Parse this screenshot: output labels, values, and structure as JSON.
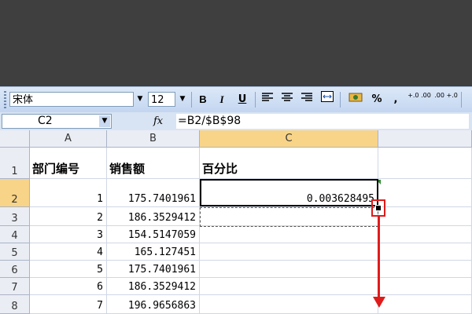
{
  "toolbar": {
    "font_name": "宋体",
    "font_size": "12",
    "bold": "B",
    "italic": "I",
    "underline": "U",
    "percent": "%",
    "comma": ",",
    "inc_decimal": "+.0 .00",
    "dec_decimal": ".00 +.0"
  },
  "formula_bar": {
    "name_box": "C2",
    "fx": "fx",
    "formula": "=B2/$B$98"
  },
  "columns": [
    "A",
    "B",
    "C"
  ],
  "selected_column": "C",
  "selected_row": "2",
  "rows": [
    {
      "row": "1",
      "a": "部门编号",
      "b": "销售额",
      "c": "百分比"
    },
    {
      "row": "2",
      "a": "1",
      "b": "175.7401961",
      "c": "0.003628495"
    },
    {
      "row": "3",
      "a": "2",
      "b": "186.3529412",
      "c": ""
    },
    {
      "row": "4",
      "a": "3",
      "b": "154.5147059",
      "c": ""
    },
    {
      "row": "5",
      "a": "4",
      "b": "165.127451",
      "c": ""
    },
    {
      "row": "6",
      "a": "5",
      "b": "175.7401961",
      "c": ""
    },
    {
      "row": "7",
      "a": "6",
      "b": "186.3529412",
      "c": ""
    },
    {
      "row": "8",
      "a": "7",
      "b": "196.9656863",
      "c": ""
    }
  ],
  "annotation_color": "#e01b1b",
  "selection_color": "#f8d488"
}
